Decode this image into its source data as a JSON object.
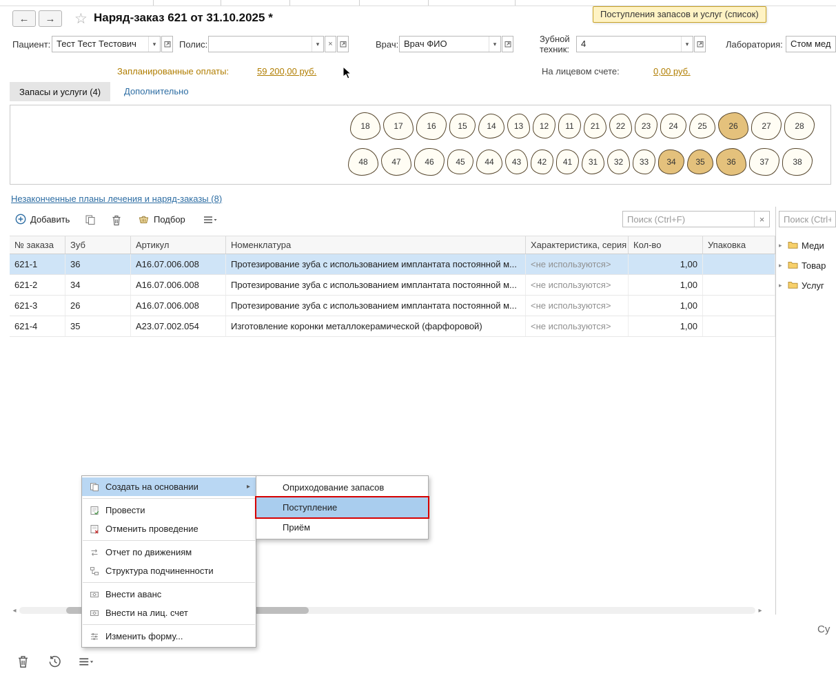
{
  "window": {
    "title": "Наряд-заказ 621 от 31.10.2025 *",
    "tooltip": "Поступления запасов и услуг (список)"
  },
  "icons": {
    "back": "←",
    "forward": "→",
    "star": "☆",
    "dropdown": "▾",
    "clear": "×",
    "chevron_right": "▸",
    "scroll_left": "◂",
    "scroll_right": "▸"
  },
  "form": {
    "patient_label": "Пациент:",
    "patient_value": "Тест Тест Тестович",
    "policy_label": "Полис:",
    "policy_value": "",
    "doctor_label": "Врач:",
    "doctor_value": "Врач ФИО",
    "technician_label_line1": "Зубной",
    "technician_label_line2": "техник:",
    "technician_value": "4",
    "lab_label": "Лаборатория:",
    "lab_value": "Стом мед"
  },
  "payments": {
    "planned_label": "Запланированные оплаты:",
    "planned_value": "59 200,00  руб.",
    "account_label": "На лицевом счете:",
    "account_value": "0,00  руб."
  },
  "tabs": {
    "inventory": "Запасы и услуги (4)",
    "additional": "Дополнительно"
  },
  "teeth": {
    "upper": [
      "18",
      "17",
      "16",
      "15",
      "14",
      "13",
      "12",
      "11",
      "21",
      "22",
      "23",
      "24",
      "25",
      "26",
      "27",
      "28"
    ],
    "lower": [
      "48",
      "47",
      "46",
      "45",
      "44",
      "43",
      "42",
      "41",
      "31",
      "32",
      "33",
      "34",
      "35",
      "36",
      "37",
      "38"
    ],
    "highlighted": [
      "26",
      "34",
      "35",
      "36"
    ]
  },
  "links": {
    "unfinished": "Незаконченные планы лечения и наряд-заказы (8)"
  },
  "toolbar": {
    "add": "Добавить",
    "pick": "Подбор",
    "search_placeholder": "Поиск (Ctrl+F)"
  },
  "sidebar": {
    "search_placeholder": "Поиск (Ctrl+F)",
    "folders": [
      "Меди",
      "Товар",
      "Услуг"
    ]
  },
  "table": {
    "columns": [
      "№ заказа",
      "Зуб",
      "Артикул",
      "Номенклатура",
      "Характеристика, серия",
      "Кол-во",
      "Упаковка"
    ],
    "rows": [
      {
        "order": "621-1",
        "tooth": "36",
        "article": "А16.07.006.008",
        "name": "Протезирование зуба с использованием имплантата постоянной м...",
        "series": "<не используются>",
        "qty": "1,00",
        "pack": "",
        "selected": true
      },
      {
        "order": "621-2",
        "tooth": "34",
        "article": "А16.07.006.008",
        "name": "Протезирование зуба с использованием имплантата постоянной м...",
        "series": "<не используются>",
        "qty": "1,00",
        "pack": "",
        "selected": false
      },
      {
        "order": "621-3",
        "tooth": "26",
        "article": "А16.07.006.008",
        "name": "Протезирование зуба с использованием имплантата постоянной м...",
        "series": "<не используются>",
        "qty": "1,00",
        "pack": "",
        "selected": false
      },
      {
        "order": "621-4",
        "tooth": "35",
        "article": "А23.07.002.054",
        "name": "Изготовление коронки металлокерамической (фарфоровой)",
        "series": "<не используются>",
        "qty": "1,00",
        "pack": "",
        "selected": false
      }
    ]
  },
  "context_menu": {
    "items": [
      {
        "label": "Создать на основании",
        "icon": "create-on-basis-icon",
        "submenu": true,
        "highlighted": true,
        "separator_after": true
      },
      {
        "label": "Провести",
        "icon": "post-icon",
        "submenu": false,
        "highlighted": false,
        "separator_after": false
      },
      {
        "label": "Отменить проведение",
        "icon": "unpost-icon",
        "submenu": false,
        "highlighted": false,
        "separator_after": true
      },
      {
        "label": "Отчет по движениям",
        "icon": "report-movements-icon",
        "submenu": false,
        "highlighted": false,
        "separator_after": false
      },
      {
        "label": "Структура подчиненности",
        "icon": "structure-icon",
        "submenu": false,
        "highlighted": false,
        "separator_after": true
      },
      {
        "label": "Внести аванс",
        "icon": "cash-icon",
        "submenu": false,
        "highlighted": false,
        "separator_after": false
      },
      {
        "label": "Внести на лиц. счет",
        "icon": "cash-icon",
        "submenu": false,
        "highlighted": false,
        "separator_after": true
      },
      {
        "label": "Изменить форму...",
        "icon": "customize-form-icon",
        "submenu": false,
        "highlighted": false,
        "separator_after": false
      }
    ]
  },
  "submenu": {
    "items": [
      {
        "label": "Оприходование запасов",
        "highlighted": false,
        "marked": false
      },
      {
        "label": "Поступление",
        "highlighted": true,
        "marked": true
      },
      {
        "label": "Приём",
        "highlighted": false,
        "marked": false
      }
    ]
  },
  "footer": {
    "sum_label": "Су"
  },
  "colors": {
    "accent_blue": "#2d6da3",
    "link_gold": "#b07d00",
    "row_selection": "#cfe4f7",
    "menu_highlight": "#b9d7f3",
    "submenu_highlight": "#a9cdee",
    "tooth_highlight": "#e4c17c",
    "tooltip_bg": "#fff3c4",
    "marker_red": "#d60000"
  }
}
